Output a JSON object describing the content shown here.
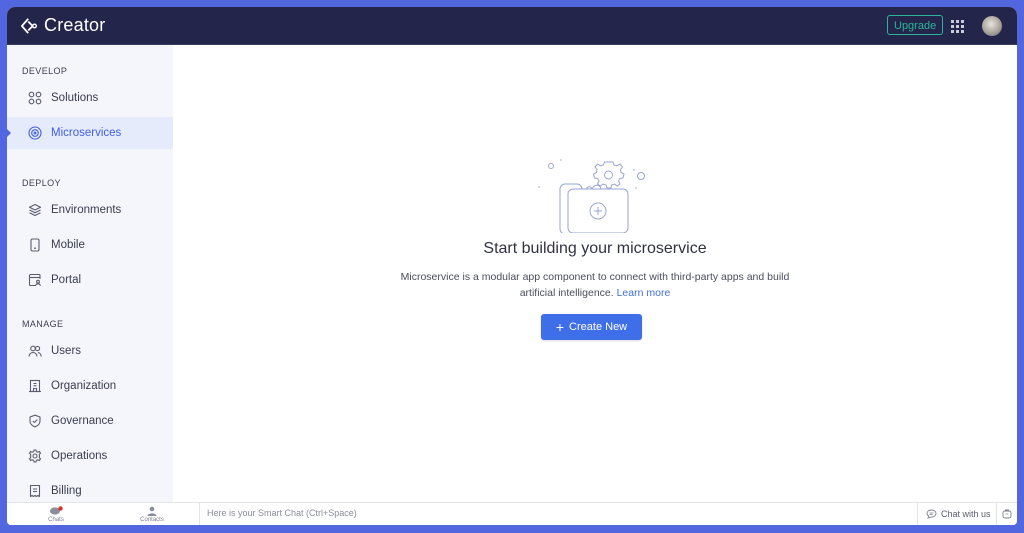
{
  "app": {
    "title": "Creator"
  },
  "header": {
    "upgrade_label": "Upgrade",
    "apps_icon": "grid-icon",
    "avatar": "user-avatar"
  },
  "sidebar": {
    "sections": [
      {
        "label": "DEVELOP",
        "items": [
          {
            "label": "Solutions",
            "icon": "solutions-icon",
            "active": false
          },
          {
            "label": "Microservices",
            "icon": "microservices-icon",
            "active": true
          }
        ]
      },
      {
        "label": "DEPLOY",
        "items": [
          {
            "label": "Environments",
            "icon": "layers-icon",
            "active": false
          },
          {
            "label": "Mobile",
            "icon": "mobile-icon",
            "active": false
          },
          {
            "label": "Portal",
            "icon": "portal-icon",
            "active": false
          }
        ]
      },
      {
        "label": "MANAGE",
        "items": [
          {
            "label": "Users",
            "icon": "users-icon",
            "active": false
          },
          {
            "label": "Organization",
            "icon": "building-icon",
            "active": false
          },
          {
            "label": "Governance",
            "icon": "shield-check-icon",
            "active": false
          },
          {
            "label": "Operations",
            "icon": "gear-icon",
            "active": false
          },
          {
            "label": "Billing",
            "icon": "receipt-icon",
            "active": false
          }
        ]
      }
    ]
  },
  "main": {
    "empty_state": {
      "title": "Start building your microservice",
      "description": "Microservice is a modular app component to connect with third-party apps and build artificial intelligence.",
      "learn_more": "Learn more",
      "create_label": "Create New"
    }
  },
  "bottombar": {
    "chats_label": "Chats",
    "contacts_label": "Contacts",
    "smart_chat_placeholder": "Here is your Smart Chat (Ctrl+Space)",
    "chat_with_us": "Chat with us",
    "colors": {
      "notification": "#e02b2b"
    }
  }
}
